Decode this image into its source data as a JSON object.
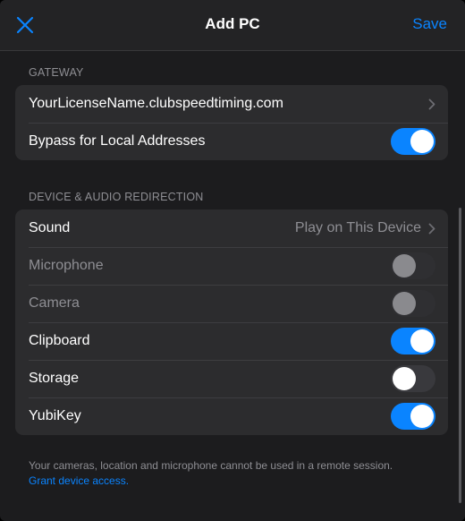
{
  "navbar": {
    "title": "Add PC",
    "save_label": "Save",
    "close_icon": "close-icon"
  },
  "gateway": {
    "header": "GATEWAY",
    "rows": [
      {
        "label": "YourLicenseName.clubspeedtiming.com",
        "control": "chevron"
      },
      {
        "label": "Bypass for Local Addresses",
        "control": "toggle",
        "on": true,
        "enabled": true
      }
    ]
  },
  "redirection": {
    "header": "DEVICE & AUDIO REDIRECTION",
    "rows": [
      {
        "label": "Sound",
        "value": "Play on This Device",
        "control": "chevron"
      },
      {
        "label": "Microphone",
        "control": "toggle",
        "on": false,
        "enabled": false
      },
      {
        "label": "Camera",
        "control": "toggle",
        "on": false,
        "enabled": false
      },
      {
        "label": "Clipboard",
        "control": "toggle",
        "on": true,
        "enabled": true
      },
      {
        "label": "Storage",
        "control": "toggle",
        "on": false,
        "enabled": true
      },
      {
        "label": "YubiKey",
        "control": "toggle",
        "on": true,
        "enabled": true
      }
    ]
  },
  "footer": {
    "text": "Your cameras, location and microphone cannot be used in a remote session.",
    "link": "Grant device access."
  },
  "colors": {
    "accent": "#0a84ff",
    "background": "#1c1c1e",
    "group_background": "#2c2c2e"
  }
}
